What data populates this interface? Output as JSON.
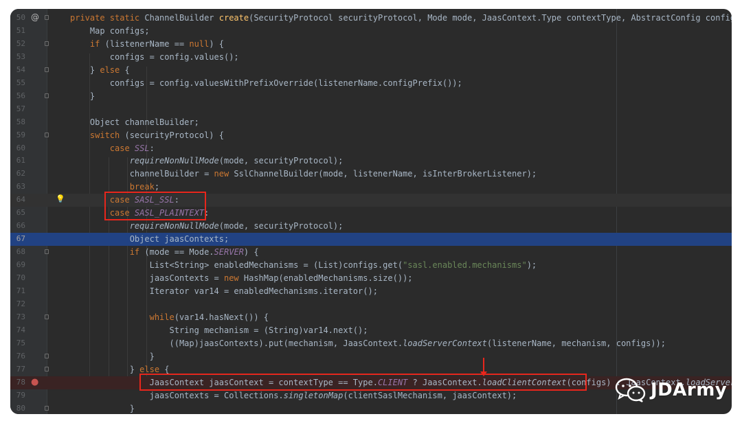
{
  "editor": {
    "lines": [
      {
        "n": "50",
        "toks": [
          [
            "private static ",
            "kw"
          ],
          [
            "ChannelBuilder ",
            ""
          ],
          [
            "create",
            "fn"
          ],
          [
            "(SecurityProtocol securityProtocol, Mode mode, JaasContext.Type contextType, AbstractConfig config, List",
            ""
          ]
        ]
      },
      {
        "n": "51",
        "toks": [
          [
            "    Map configs;",
            ""
          ]
        ]
      },
      {
        "n": "52",
        "toks": [
          [
            "    ",
            ""
          ],
          [
            "if ",
            "kw"
          ],
          [
            "(listenerName == ",
            ""
          ],
          [
            "null",
            "kw"
          ],
          [
            ") {",
            ""
          ]
        ]
      },
      {
        "n": "53",
        "toks": [
          [
            "        configs = config.values();",
            ""
          ]
        ]
      },
      {
        "n": "54",
        "toks": [
          [
            "    } ",
            ""
          ],
          [
            "else ",
            "kw"
          ],
          [
            "{",
            ""
          ]
        ]
      },
      {
        "n": "55",
        "toks": [
          [
            "        configs = config.valuesWithPrefixOverride(listenerName.configPrefix());",
            ""
          ]
        ]
      },
      {
        "n": "56",
        "toks": [
          [
            "    }",
            ""
          ]
        ]
      },
      {
        "n": "57",
        "toks": []
      },
      {
        "n": "58",
        "toks": [
          [
            "    Object channelBuilder;",
            ""
          ]
        ]
      },
      {
        "n": "59",
        "toks": [
          [
            "    ",
            ""
          ],
          [
            "switch ",
            "kw"
          ],
          [
            "(securityProtocol) {",
            ""
          ]
        ]
      },
      {
        "n": "60",
        "toks": [
          [
            "        ",
            ""
          ],
          [
            "case ",
            "kw"
          ],
          [
            "SSL",
            "st"
          ],
          [
            ":",
            ""
          ]
        ]
      },
      {
        "n": "61",
        "toks": [
          [
            "            ",
            ""
          ],
          [
            "requireNonNullMode",
            "it"
          ],
          [
            "(mode, securityProtocol);",
            ""
          ]
        ]
      },
      {
        "n": "62",
        "toks": [
          [
            "            channelBuilder = ",
            ""
          ],
          [
            "new ",
            "kw"
          ],
          [
            "SslChannelBuilder(mode, listenerName, isInterBrokerListener);",
            ""
          ]
        ]
      },
      {
        "n": "63",
        "toks": [
          [
            "            ",
            ""
          ],
          [
            "break",
            "kw"
          ],
          [
            ";",
            ""
          ]
        ]
      },
      {
        "n": "64",
        "toks": [
          [
            "        ",
            ""
          ],
          [
            "case ",
            "kw"
          ],
          [
            "SASL_SSL",
            "st"
          ],
          [
            ":",
            ""
          ]
        ]
      },
      {
        "n": "65",
        "toks": [
          [
            "        ",
            ""
          ],
          [
            "case ",
            "kw"
          ],
          [
            "SASL_PLAINTEXT",
            "st"
          ],
          [
            ":",
            ""
          ]
        ]
      },
      {
        "n": "66",
        "toks": [
          [
            "            ",
            ""
          ],
          [
            "requireNonNullMode",
            "it"
          ],
          [
            "(mode, securityProtocol);",
            ""
          ]
        ]
      },
      {
        "n": "67",
        "toks": [
          [
            "            Object jaasContexts;",
            ""
          ]
        ]
      },
      {
        "n": "68",
        "toks": [
          [
            "            ",
            ""
          ],
          [
            "if ",
            "kw"
          ],
          [
            "(mode == Mode.",
            ""
          ],
          [
            "SERVER",
            "st"
          ],
          [
            ") {",
            ""
          ]
        ]
      },
      {
        "n": "69",
        "toks": [
          [
            "                List<String> enabledMechanisms = (List)configs.get(",
            ""
          ],
          [
            "\"sasl.enabled.mechanisms\"",
            "str"
          ],
          [
            ");",
            ""
          ]
        ]
      },
      {
        "n": "70",
        "toks": [
          [
            "                jaasContexts = ",
            ""
          ],
          [
            "new ",
            "kw"
          ],
          [
            "HashMap(enabledMechanisms.size());",
            ""
          ]
        ]
      },
      {
        "n": "71",
        "toks": [
          [
            "                Iterator var14 = enabledMechanisms.iterator();",
            ""
          ]
        ]
      },
      {
        "n": "72",
        "toks": []
      },
      {
        "n": "73",
        "toks": [
          [
            "                ",
            ""
          ],
          [
            "while",
            "kw"
          ],
          [
            "(var14.hasNext()) {",
            ""
          ]
        ]
      },
      {
        "n": "74",
        "toks": [
          [
            "                    String mechanism = (String)var14.next();",
            ""
          ]
        ]
      },
      {
        "n": "75",
        "toks": [
          [
            "                    ((Map)jaasContexts).put(mechanism, JaasContext.",
            ""
          ],
          [
            "loadServerContext",
            "it"
          ],
          [
            "(listenerName, mechanism, configs));",
            ""
          ]
        ]
      },
      {
        "n": "76",
        "toks": [
          [
            "                }",
            ""
          ]
        ]
      },
      {
        "n": "77",
        "toks": [
          [
            "            } ",
            ""
          ],
          [
            "else ",
            "kw"
          ],
          [
            "{",
            ""
          ]
        ]
      },
      {
        "n": "78",
        "toks": [
          [
            "                JaasContext jaasContext = contextType == Type.",
            ""
          ],
          [
            "CLIENT",
            "st"
          ],
          [
            " ? JaasContext.",
            ""
          ],
          [
            "loadClientContext",
            "it"
          ],
          [
            "(configs) : JaasContext.",
            ""
          ],
          [
            "loadServerContext",
            "it"
          ],
          [
            "(",
            ""
          ]
        ]
      },
      {
        "n": "79",
        "toks": [
          [
            "                jaasContexts = Collections.",
            ""
          ],
          [
            "singletonMap",
            "it"
          ],
          [
            "(clientSaslMechanism, jaasContext);",
            ""
          ]
        ]
      },
      {
        "n": "80",
        "toks": [
          [
            "            }",
            ""
          ]
        ]
      }
    ]
  },
  "gutter_icons": {
    "annotation": "@",
    "bulb": "💡",
    "breakpoint": "●"
  },
  "watermark": {
    "brand": "JDArmy"
  },
  "colors": {
    "background": "#2b2b2b",
    "keyword": "#cc7832",
    "method": "#ffc66d",
    "static_field": "#9876aa",
    "string": "#6a8759",
    "text": "#a9b7c6",
    "selection": "#214283",
    "highlight_box": "#e8261c"
  }
}
